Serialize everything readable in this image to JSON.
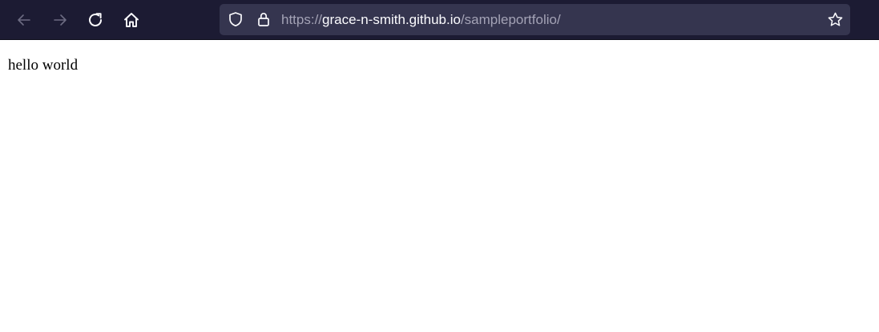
{
  "toolbar": {
    "nav": [
      {
        "name": "back",
        "icon": "arrow-left-icon",
        "enabled": false
      },
      {
        "name": "forward",
        "icon": "arrow-right-icon",
        "enabled": false
      },
      {
        "name": "reload",
        "icon": "reload-icon",
        "enabled": true
      },
      {
        "name": "home",
        "icon": "home-icon",
        "enabled": true
      }
    ],
    "url": {
      "scheme": "https://",
      "host": "grace-n-smith.github.io",
      "path": "/sampleportfolio/"
    },
    "icons": {
      "tracking_protection": "shield-icon",
      "security": "lock-icon",
      "bookmark": "star-icon"
    }
  },
  "colors": {
    "toolbar_bg": "#1c1b33",
    "urlbar_bg": "#35354f",
    "url_host": "#fbfbfe",
    "url_dim": "#a3a2b5",
    "page_bg": "#ffffff"
  },
  "page": {
    "text": "hello world"
  }
}
